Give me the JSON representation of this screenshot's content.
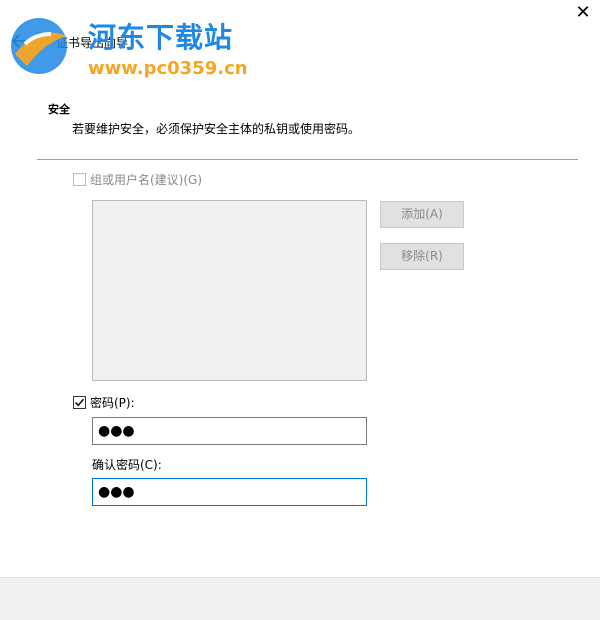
{
  "window": {
    "title": "证书导出向导",
    "close_glyph": "✕"
  },
  "watermark": {
    "site_name": "河东下载站",
    "url": "www.pc0359.cn"
  },
  "section": {
    "title": "安全",
    "description": "若要维护安全，必须保护安全主体的私钥或使用密码。"
  },
  "form": {
    "group_or_user_label": "组或用户名(建议)(G)",
    "group_or_user_checked": false,
    "add_button": "添加(A)",
    "remove_button": "移除(R)",
    "password_label": "密码(P):",
    "password_checked": true,
    "password_value": "●●●",
    "confirm_label": "确认密码(C):",
    "confirm_value": "●●●"
  },
  "colors": {
    "accent_blue": "#0078d7",
    "watermark_blue": "#1e88e5",
    "watermark_orange": "#f5a623",
    "disabled_text": "#8a8a8a"
  }
}
